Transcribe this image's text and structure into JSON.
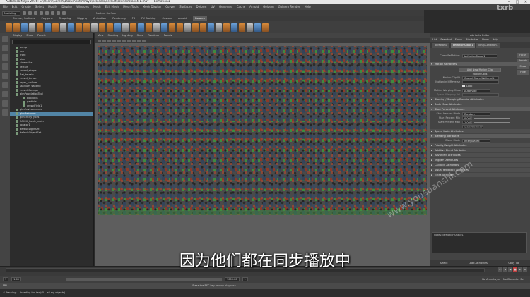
{
  "window": {
    "title": "Autodesk Maya 2016: C:\\Users\\Gareth\\Documents\\maya\\projects\\default\\scenes\\class4-1.ma*   ---   beMotion1",
    "minimize": "–",
    "maximize": "□",
    "close": "✕"
  },
  "menubar": [
    "File",
    "Edit",
    "Create",
    "Select",
    "Modify",
    "Display",
    "Windows",
    "Mesh",
    "Edit Mesh",
    "Mesh Tools",
    "Mesh Display",
    "Curves",
    "Surfaces",
    "Deform",
    "UV",
    "Generate",
    "Cache",
    "Arnold",
    "Golaem",
    "Golaem Render",
    "Help"
  ],
  "status": {
    "mode": "Modeling",
    "symmetry": "No Live Surface"
  },
  "shelf_tabs": [
    "Curves / Surfaces",
    "Polygons",
    "Sculpting",
    "Rigging",
    "Animation",
    "Rendering",
    "FX",
    "FX Caching",
    "Custom",
    "Arnold",
    "Golaem"
  ],
  "shelf_active": "Golaem",
  "outliner": {
    "menu": [
      "Display",
      "Show",
      "Panels"
    ],
    "items": [
      {
        "label": "persp",
        "sel": false
      },
      {
        "label": "top",
        "sel": false
      },
      {
        "label": "front",
        "sel": false
      },
      {
        "label": "side",
        "sel": false
      },
      {
        "label": "sidewalks",
        "sel": false
      },
      {
        "label": "terrain",
        "sel": false
      },
      {
        "label": "crowd_shape",
        "sel": false
      },
      {
        "label": "flat_terrain",
        "sel": false
      },
      {
        "label": "crowd_terrain",
        "sel": false
      },
      {
        "label": "layer_surface",
        "sel": false
      },
      {
        "label": "stadium_seating",
        "sel": false
      },
      {
        "label": "crowdManager",
        "sel": false
      },
      {
        "label": "glmPopulationTool",
        "sel": false
      },
      {
        "label": "popTool1",
        "sel": false
      },
      {
        "label": "particle1",
        "sel": false
      },
      {
        "label": "crowdField1",
        "sel": false
      },
      {
        "label": "glmEnvironments",
        "sel": false
      },
      {
        "label": "glmBehavior",
        "sel": true
      },
      {
        "label": "glmEntityTypes",
        "sel": false
      },
      {
        "label": "ASHHI_houle_main",
        "sel": false
      },
      {
        "label": "locator1",
        "sel": false
      },
      {
        "label": "defaultLightSet",
        "sel": false
      },
      {
        "label": "defaultObjectSet",
        "sel": false
      }
    ]
  },
  "viewport": {
    "menu": [
      "View",
      "Shading",
      "Lighting",
      "Show",
      "Renderer",
      "Panels"
    ]
  },
  "attribute_editor": {
    "title": "Attribute Editor",
    "menu": [
      "List",
      "Selected",
      "Focus",
      "Attributes",
      "Show",
      "Help"
    ],
    "tabs": [
      "beMotion1",
      "beMotionShape1",
      "beOpCondition1"
    ],
    "active_tab": "beMotionShape1",
    "side_buttons": [
      "Focus",
      "Presets",
      "Show",
      "Hide"
    ],
    "node_label": "CrowdBeMotion:",
    "node_value": "beMotionShape1",
    "motion_header": "Motion Attributes",
    "add_button": "Add New Motion Clip",
    "clips_label": "Motion Clips",
    "clip_id_label": "Motion Clip ID",
    "clip_id_value": "Casual_Stand/Walking/A",
    "if_motion_label": "Motion in If/Reverse",
    "loop_label": "Loop",
    "warping_label": "Motion Warping Mode",
    "warping_value": "Automatic",
    "speed_label": "Speed Warping Val",
    "sections_a": [
      "Starting / Stopping Duration Attributes",
      "Body Mask Attributes"
    ],
    "start_header": "Start Percent Attributes",
    "start_mode_label": "Start Percent Mode",
    "start_mode_value": "Random",
    "min_label": "Start Percent Min",
    "min_value": "0.000",
    "max_label": "Start Percent Max",
    "max_value": "1.000",
    "seed_placeholder": "StartPercentPP",
    "sections_b": [
      "Speed Ratio Attributes",
      "Blending Attributes"
    ],
    "blend_label": "Blend Mode",
    "blend_value": "Interpolated",
    "sections_c": [
      "Priority/Weight Attributes",
      "Additive Blend Attributes",
      "Advanced Attributes",
      "Triggers Attributes",
      "Callback Attributes",
      "Visual Feedback Attributes",
      "Extra Attributes"
    ],
    "notes_label": "Notes: beMotionShape1",
    "bottom_buttons": [
      "Select",
      "Load Attributes",
      "Copy Tab"
    ]
  },
  "timeline": {
    "start": "1",
    "end": "1",
    "range_start": "1.00",
    "range_end": "1000.00",
    "anim_layer": "No Anim Layer",
    "character": "No Character Set"
  },
  "helpline": "Press the ESC key to stop playback.",
  "cmd_label": "MEL",
  "cmd_status": "# Warning: ... heading too far (GL...all my objects)",
  "subtitle": "因为他们都在同步播放中",
  "watermark": "www.yousuanshi.com",
  "logo": "txrb"
}
